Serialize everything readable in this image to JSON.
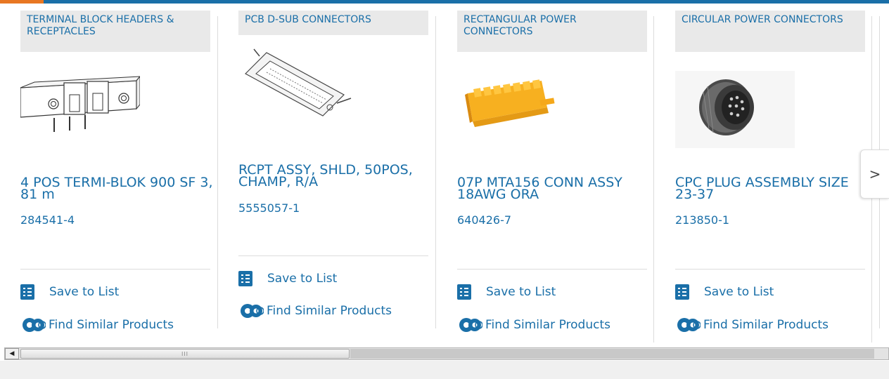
{
  "colors": {
    "link": "#1a6fa8",
    "accent": "#e87722",
    "category_bg": "#e9e9e9"
  },
  "carousel": {
    "next_icon": "chevron-right-icon",
    "next_glyph": ">",
    "cards": [
      {
        "category": "TERMINAL BLOCK HEADERS & RECEPTACLES",
        "title": "4 POS TERMI-BLOK 900 SF 3, 81 m",
        "part_number": "284541-4",
        "save_label": "Save to List",
        "similar_label": "Find Similar Products"
      },
      {
        "category": "PCB D-SUB CONNECTORS",
        "title": "RCPT ASSY, SHLD, 50POS, CHAMP, R/A",
        "part_number": "5555057-1",
        "save_label": "Save to List",
        "similar_label": "Find Similar Products"
      },
      {
        "category": "RECTANGULAR POWER CONNECTORS",
        "title": "07P MTA156 CONN ASSY 18AWG ORA",
        "part_number": "640426-7",
        "save_label": "Save to List",
        "similar_label": "Find Similar Products"
      },
      {
        "category": "CIRCULAR POWER CONNECTORS",
        "title": "CPC PLUG ASSEMBLY SIZE 23-37",
        "part_number": "213850-1",
        "save_label": "Save to List",
        "similar_label": "Find Similar Products"
      }
    ]
  },
  "scrollbar": {
    "left_arrow": "◀",
    "grip": "III"
  }
}
